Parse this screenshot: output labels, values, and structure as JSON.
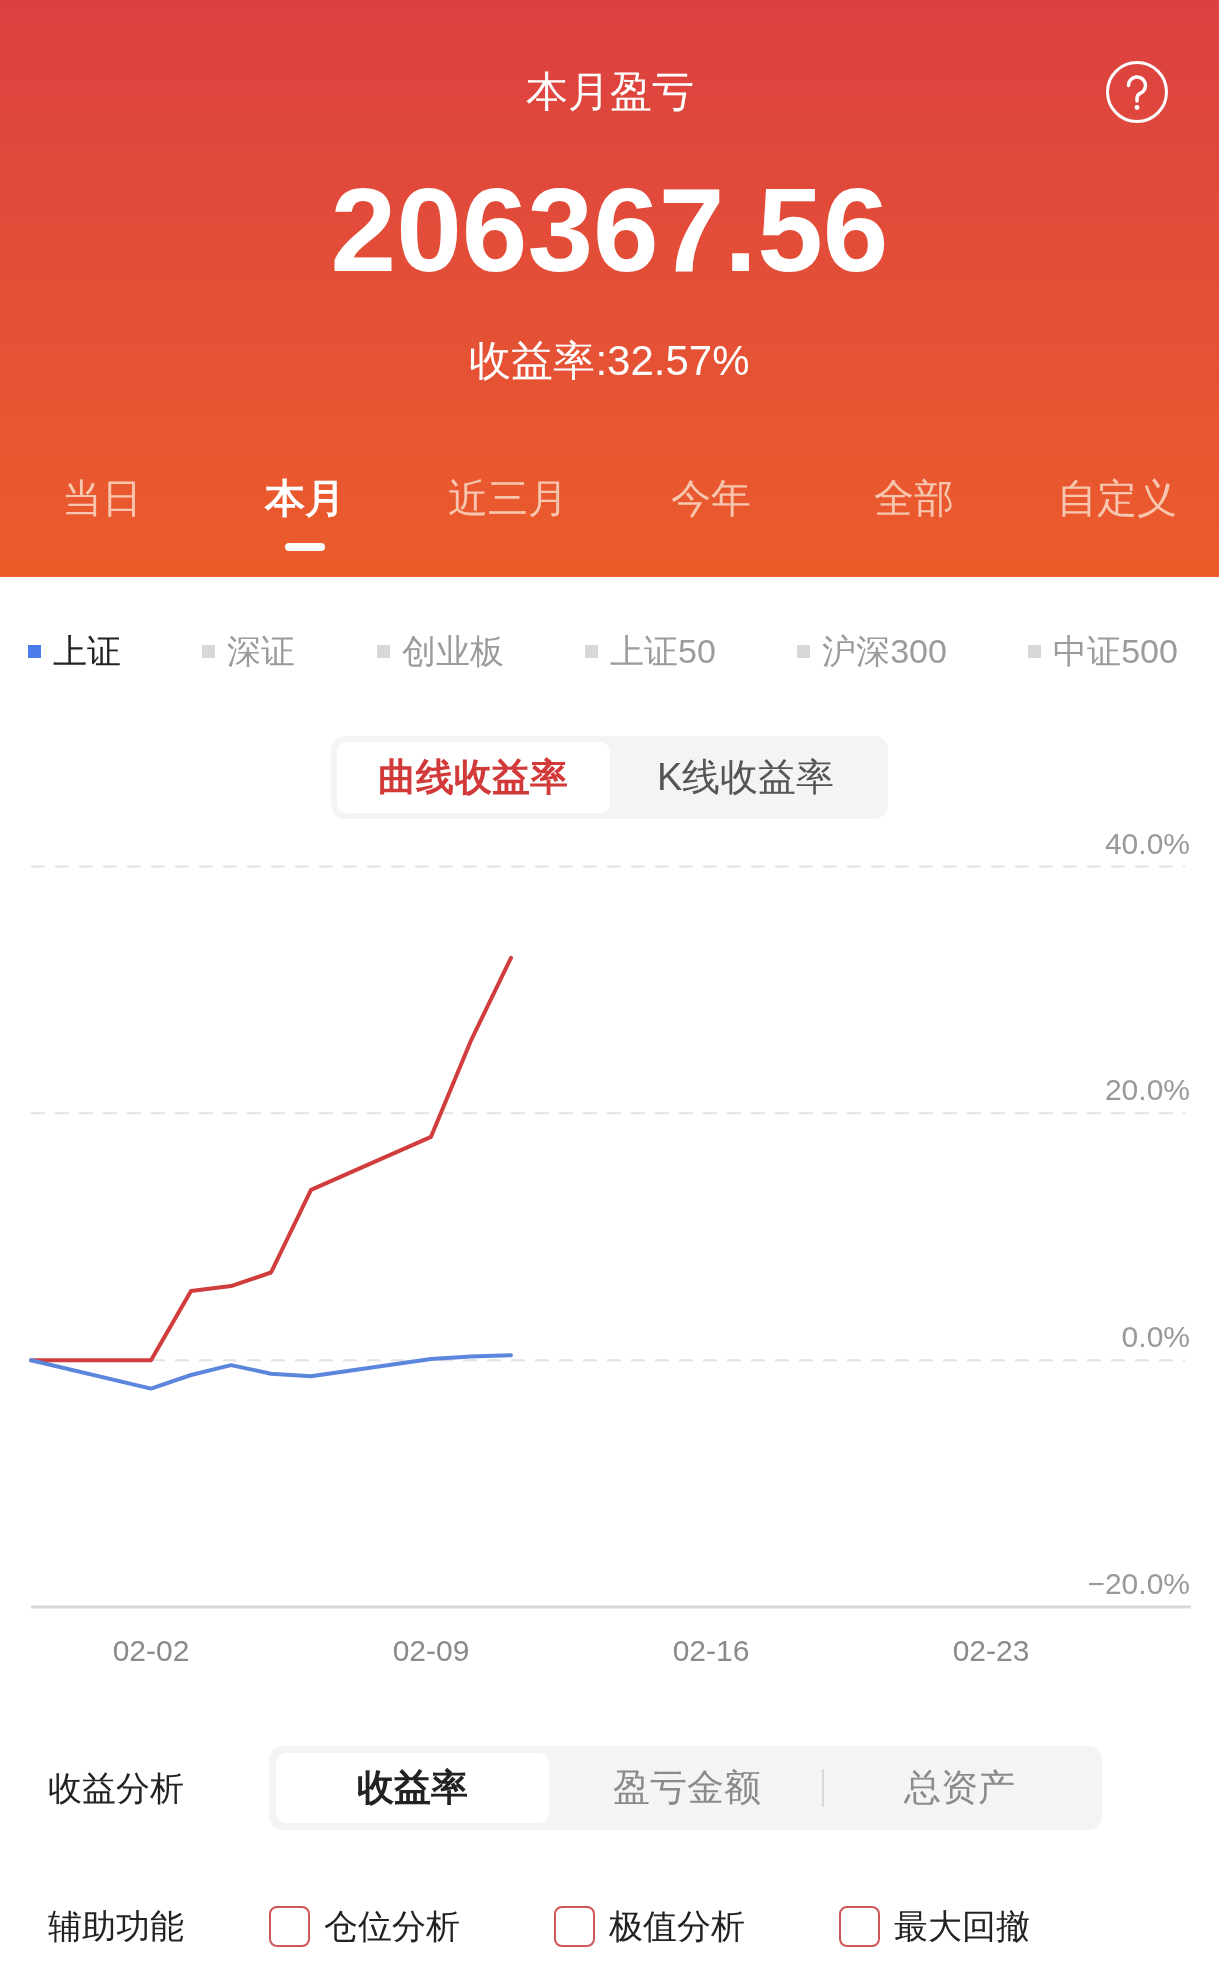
{
  "header": {
    "title": "本月盈亏",
    "amount": "206367.56",
    "rate": "收益率:32.57%"
  },
  "period_tabs": [
    {
      "label": "当日",
      "selected": false
    },
    {
      "label": "本月",
      "selected": true
    },
    {
      "label": "近三月",
      "selected": false
    },
    {
      "label": "今年",
      "selected": false
    },
    {
      "label": "全部",
      "selected": false
    },
    {
      "label": "自定义",
      "selected": false
    }
  ],
  "index_legend": [
    {
      "label": "上证",
      "selected": true
    },
    {
      "label": "深证",
      "selected": false
    },
    {
      "label": "创业板",
      "selected": false
    },
    {
      "label": "上证50",
      "selected": false
    },
    {
      "label": "沪深300",
      "selected": false
    },
    {
      "label": "中证500",
      "selected": false
    }
  ],
  "chart_mode_toggle": [
    {
      "label": "曲线收益率",
      "selected": true
    },
    {
      "label": "K线收益率",
      "selected": false
    }
  ],
  "chart": {
    "chart_data": {
      "type": "line",
      "categories": [
        null,
        null,
        null,
        "02-02",
        null,
        null,
        null,
        null,
        null,
        null,
        "02-09",
        null,
        null,
        null,
        null,
        null,
        null,
        "02-16",
        null,
        null,
        null,
        null,
        null,
        null,
        "02-23",
        null,
        null,
        null,
        null,
        null
      ],
      "series": [
        {
          "color": "#d13c3c",
          "values": [
            0,
            null,
            null,
            0,
            5.6,
            6.0,
            7.1,
            13.8,
            null,
            null,
            18.1,
            25.9,
            32.6,
            null,
            null,
            null,
            null,
            null,
            null,
            null,
            null,
            null,
            null,
            null,
            null,
            null,
            null,
            null,
            null,
            null
          ]
        },
        {
          "color": "#5b86db",
          "values": [
            0,
            null,
            null,
            -2.3,
            -1.2,
            -0.4,
            -1.1,
            -1.3,
            null,
            null,
            0.1,
            0.3,
            0.4,
            null,
            null,
            null,
            null,
            null,
            null,
            null,
            null,
            null,
            null,
            null,
            null,
            null,
            null,
            null,
            null,
            null
          ]
        }
      ],
      "ylim": [
        -20,
        40
      ],
      "yticks": [
        {
          "value": 40,
          "label": "40.0%"
        },
        {
          "value": 20,
          "label": "20.0%"
        },
        {
          "value": 0,
          "label": "0.0%"
        },
        {
          "value": -20,
          "label": "−20.0%"
        }
      ]
    }
  },
  "analysis": {
    "label": "收益分析",
    "options": [
      {
        "label": "收益率",
        "selected": true
      },
      {
        "label": "盈亏金额",
        "selected": false
      },
      {
        "label": "总资产",
        "selected": false
      }
    ]
  },
  "aux_functions": {
    "label": "辅助功能",
    "options": [
      {
        "label": "仓位分析",
        "checked": false
      },
      {
        "label": "极值分析",
        "checked": false
      },
      {
        "label": "最大回撤",
        "checked": false
      }
    ]
  }
}
